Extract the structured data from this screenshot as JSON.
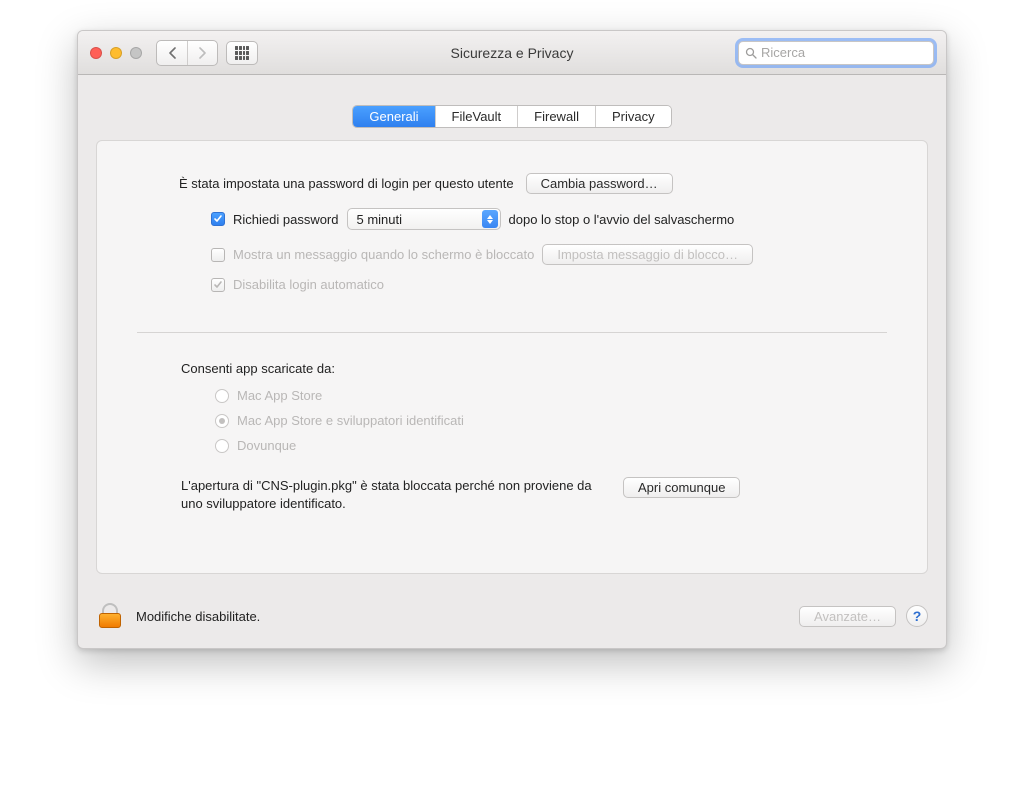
{
  "window": {
    "title": "Sicurezza e Privacy"
  },
  "toolbar": {
    "search_placeholder": "Ricerca"
  },
  "tabs": {
    "generali": "Generali",
    "filevault": "FileVault",
    "firewall": "Firewall",
    "privacy": "Privacy",
    "active": "Generali"
  },
  "general": {
    "password_set_label": "È stata impostata una password di login per questo utente",
    "change_password_btn": "Cambia password…",
    "require_password_label": "Richiedi password",
    "require_password_delay_selected": "5 minuti",
    "require_password_suffix": "dopo lo stop o l'avvio del salvaschermo",
    "show_message_label": "Mostra un messaggio quando lo schermo è bloccato",
    "set_lock_message_btn": "Imposta messaggio di blocco…",
    "disable_autologin_label": "Disabilita login automatico"
  },
  "gatekeeper": {
    "section_label": "Consenti app scaricate da:",
    "option_appstore": "Mac App Store",
    "option_identified": "Mac App Store e sviluppatori identificati",
    "option_anywhere": "Dovunque",
    "selected": "identified",
    "blocked_message": "L'apertura di \"CNS-plugin.pkg\" è stata bloccata perché non proviene da uno sviluppatore identificato.",
    "open_anyway_btn": "Apri comunque"
  },
  "footer": {
    "lock_label": "Modifiche disabilitate.",
    "advanced_btn": "Avanzate…"
  }
}
